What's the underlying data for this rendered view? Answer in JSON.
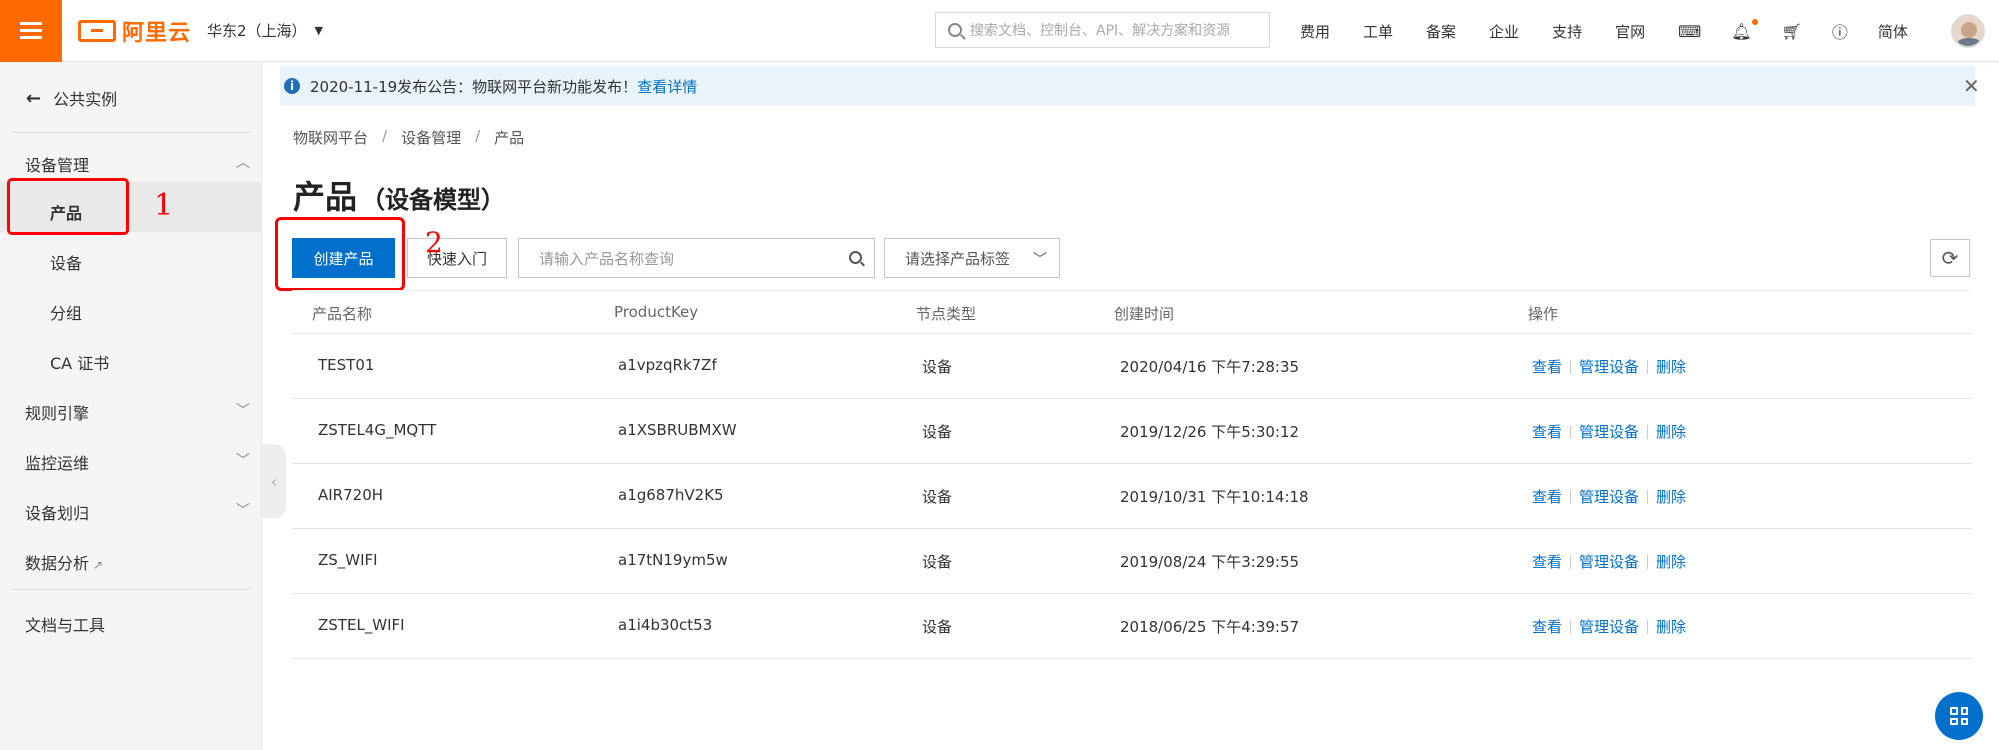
{
  "topbar": {
    "logo_text": "阿里云",
    "region": "华东2（上海）",
    "search_placeholder": "搜索文档、控制台、API、解决方案和资源",
    "nav_links": [
      "费用",
      "工单",
      "备案",
      "企业",
      "支持",
      "官网"
    ],
    "lang": "简体"
  },
  "sidebar": {
    "back_label": "公共实例",
    "groups": {
      "device_mgmt": "设备管理",
      "items": [
        "产品",
        "设备",
        "分组",
        "CA 证书"
      ],
      "rules": "规则引擎",
      "monitor": "监控运维",
      "assign": "设备划归",
      "analytics": "数据分析",
      "docs": "文档与工具"
    },
    "annotation_1": "1"
  },
  "notice": {
    "text": "2020-11-19发布公告：物联网平台新功能发布！",
    "link": "查看详情"
  },
  "breadcrumb": [
    "物联网平台",
    "设备管理",
    "产品"
  ],
  "page": {
    "title": "产品",
    "subtitle": "（设备模型）"
  },
  "toolbar": {
    "create_label": "创建产品",
    "quickstart_label": "快速入门",
    "search_placeholder": "请输入产品名称查询",
    "tag_placeholder": "请选择产品标签",
    "annotation_2": "2"
  },
  "table": {
    "headers": [
      "产品名称",
      "ProductKey",
      "节点类型",
      "创建时间",
      "操作"
    ],
    "rows": [
      {
        "name": "TEST01",
        "key": "a1vpzqRk7Zf",
        "node": "设备",
        "created": "2020/04/16 下午7:28:35"
      },
      {
        "name": "ZSTEL4G_MQTT",
        "key": "a1XSBRUBMXW",
        "node": "设备",
        "created": "2019/12/26 下午5:30:12"
      },
      {
        "name": "AIR720H",
        "key": "a1g687hV2K5",
        "node": "设备",
        "created": "2019/10/31 下午10:14:18"
      },
      {
        "name": "ZS_WIFI",
        "key": "a17tN19ym5w",
        "node": "设备",
        "created": "2019/08/24 下午3:29:55"
      },
      {
        "name": "ZSTEL_WIFI",
        "key": "a1i4b30ct53",
        "node": "设备",
        "created": "2018/06/25 下午4:39:57"
      }
    ],
    "ops": [
      "查看",
      "管理设备",
      "删除"
    ]
  },
  "colors": {
    "brand": "#ff6a00",
    "primary": "#0070cc",
    "annotation": "#ff0000"
  }
}
